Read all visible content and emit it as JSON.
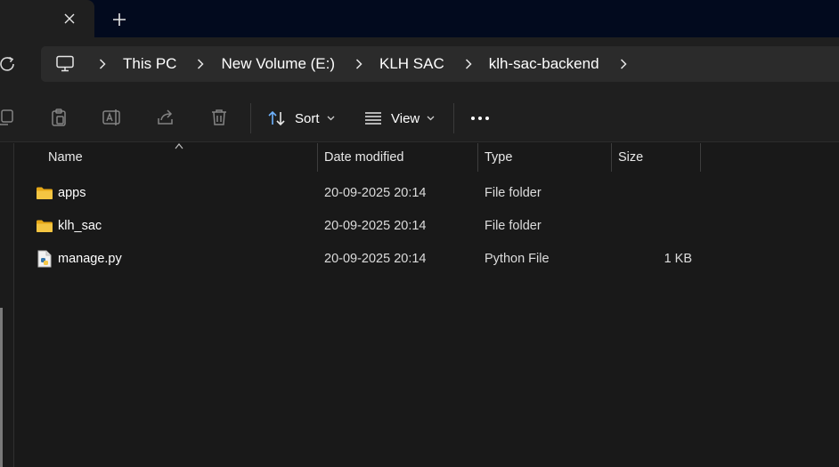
{
  "tabs": {
    "close_glyph": "✕",
    "new_glyph": "+"
  },
  "breadcrumb": {
    "items": [
      "This PC",
      "New Volume (E:)",
      "KLH SAC",
      "klh-sac-backend"
    ]
  },
  "toolbar": {
    "sort_label": "Sort",
    "view_label": "View"
  },
  "columns": {
    "name": "Name",
    "date": "Date modified",
    "type": "Type",
    "size": "Size"
  },
  "files": [
    {
      "name": "apps",
      "date": "20-09-2025 20:14",
      "type": "File folder",
      "size": "",
      "icon": "folder-icon"
    },
    {
      "name": "klh_sac",
      "date": "20-09-2025 20:14",
      "type": "File folder",
      "size": "",
      "icon": "folder-icon"
    },
    {
      "name": "manage.py",
      "date": "20-09-2025 20:14",
      "type": "Python File",
      "size": "1 KB",
      "icon": "python-file-icon"
    }
  ],
  "colors": {
    "tabstrip": "#020a1e",
    "background": "#191919",
    "folder": "#f4c542",
    "accent": "#6fb3ff"
  }
}
